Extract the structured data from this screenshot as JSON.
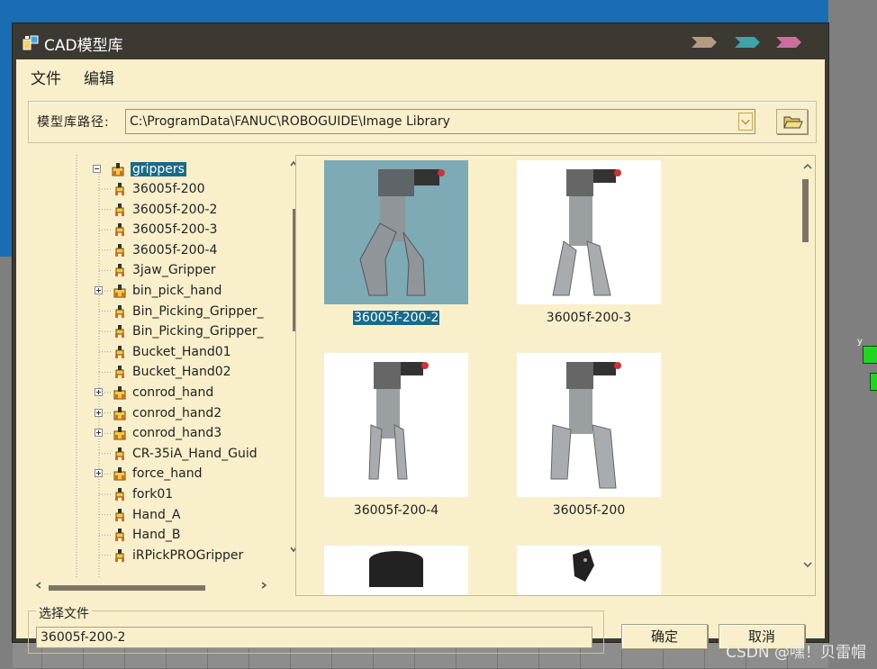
{
  "window": {
    "title": "CAD模型库"
  },
  "menu": {
    "items": [
      "文件",
      "编辑"
    ]
  },
  "path": {
    "label": "模型库路径:",
    "value": "C:\\ProgramData\\FANUC\\ROBOGUIDE\\Image Library"
  },
  "tree": {
    "root": "grippers",
    "items": [
      {
        "label": "36005f-200",
        "expandable": false
      },
      {
        "label": "36005f-200-2",
        "expandable": false
      },
      {
        "label": "36005f-200-3",
        "expandable": false
      },
      {
        "label": "36005f-200-4",
        "expandable": false
      },
      {
        "label": "3jaw_Gripper",
        "expandable": false
      },
      {
        "label": "bin_pick_hand",
        "expandable": true
      },
      {
        "label": "Bin_Picking_Gripper_",
        "expandable": false
      },
      {
        "label": "Bin_Picking_Gripper_",
        "expandable": false
      },
      {
        "label": "Bucket_Hand01",
        "expandable": false
      },
      {
        "label": "Bucket_Hand02",
        "expandable": false
      },
      {
        "label": "conrod_hand",
        "expandable": true
      },
      {
        "label": "conrod_hand2",
        "expandable": true
      },
      {
        "label": "conrod_hand3",
        "expandable": true
      },
      {
        "label": "CR-35iA_Hand_Guid",
        "expandable": false
      },
      {
        "label": "force_hand",
        "expandable": true
      },
      {
        "label": "fork01",
        "expandable": false
      },
      {
        "label": "Hand_A",
        "expandable": false
      },
      {
        "label": "Hand_B",
        "expandable": false
      },
      {
        "label": "iRPickPROGripper",
        "expandable": false
      }
    ]
  },
  "gallery": {
    "items": [
      {
        "caption": "36005f-200-2",
        "selected": true
      },
      {
        "caption": "36005f-200-3",
        "selected": false
      },
      {
        "caption": "36005f-200-4",
        "selected": false
      },
      {
        "caption": "36005f-200",
        "selected": false
      }
    ]
  },
  "selection": {
    "legend": "选择文件",
    "value": "36005f-200-2"
  },
  "buttons": {
    "ok": "确定",
    "cancel": "取消"
  },
  "watermark": "CSDN @嘿！贝雷帽",
  "colors": {
    "window_bg": "#f9efcb",
    "titlebar": "#3c3933",
    "selection": "#1a6a8a",
    "scroll_thumb": "#7e7463"
  }
}
